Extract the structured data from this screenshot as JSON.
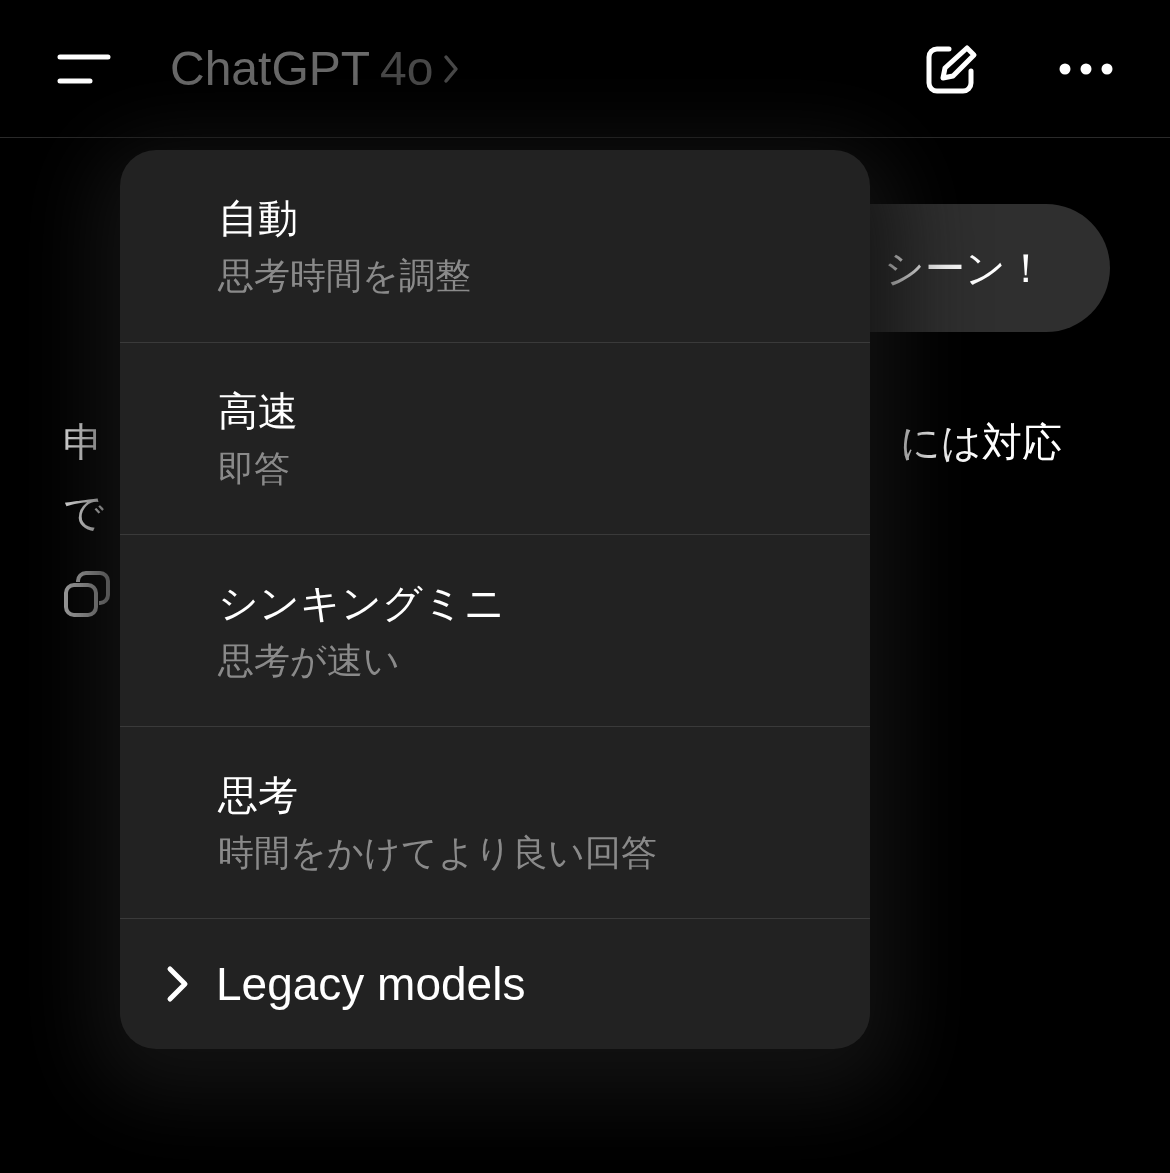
{
  "header": {
    "title": "ChatGPT",
    "model": "4o"
  },
  "conversation": {
    "user_message": "シーン！",
    "assistant_lines": [
      {
        "left": "申",
        "right": "には対応"
      },
      {
        "left": "で"
      }
    ]
  },
  "menu": {
    "items": [
      {
        "kind": "option",
        "title": "自動",
        "subtitle": "思考時間を調整"
      },
      {
        "kind": "option",
        "title": "高速",
        "subtitle": "即答"
      },
      {
        "kind": "option",
        "title": "シンキングミニ",
        "subtitle": "思考が速い"
      },
      {
        "kind": "option",
        "title": "思考",
        "subtitle": "時間をかけてより良い回答"
      },
      {
        "kind": "submenu",
        "title": "Legacy models"
      }
    ]
  }
}
